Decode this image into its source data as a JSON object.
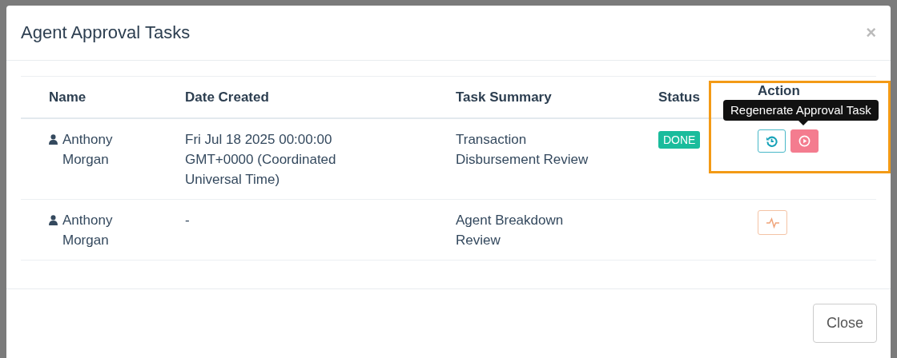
{
  "modal": {
    "title": "Agent Approval Tasks",
    "close": "×",
    "table": {
      "columns": [
        "Name",
        "Date Created",
        "Task Summary",
        "Status",
        "Action"
      ],
      "rows": [
        {
          "name": "Anthony Morgan",
          "date_created": "Fri Jul 18 2025 00:00:00 GMT+0000 (Coordinated Universal Time)",
          "task_summary": "Transaction Disbursement Review",
          "status": "DONE",
          "actions": [
            {
              "kind": "history"
            },
            {
              "kind": "play"
            }
          ]
        },
        {
          "name": "Anthony Morgan",
          "date_created": "-",
          "task_summary": "Agent Breakdown Review",
          "actions": [
            {
              "kind": "activity"
            }
          ]
        }
      ]
    },
    "tooltip": {
      "text": "Regenerate Approval Task"
    },
    "footer_button": "Close"
  }
}
